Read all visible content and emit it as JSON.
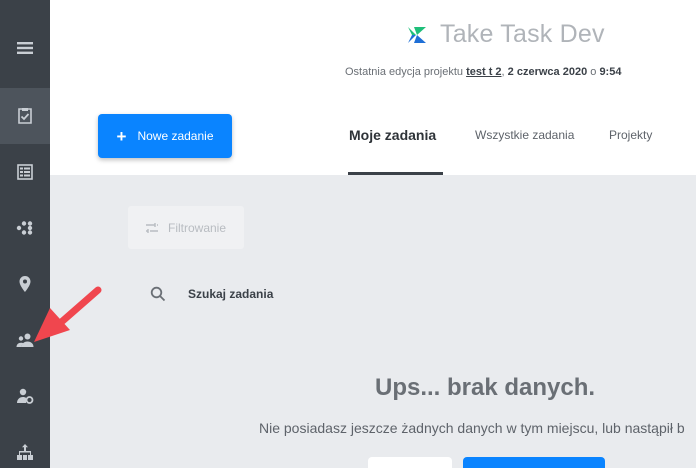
{
  "sidebar": {
    "items": [
      {
        "icon": "menu-icon"
      },
      {
        "icon": "task-check-icon",
        "active": true
      },
      {
        "icon": "checklist-icon"
      },
      {
        "icon": "nodes-icon"
      },
      {
        "icon": "location-pin-icon"
      },
      {
        "icon": "users-icon"
      },
      {
        "icon": "user-settings-icon"
      },
      {
        "icon": "org-chart-icon"
      }
    ]
  },
  "header": {
    "app_name": "Take Task Dev",
    "last_edit_prefix": "Ostatnia edycja projektu",
    "last_edit_project": "test t 2",
    "last_edit_date": "2 czerwca 2020",
    "last_edit_sep": "o",
    "last_edit_time": "9:54",
    "new_task_plus": "+",
    "new_task_label": "Nowe zadanie",
    "tabs": [
      {
        "label": "Moje zadania",
        "active": true
      },
      {
        "label": "Wszystkie zadania"
      },
      {
        "label": "Projekty"
      }
    ]
  },
  "content": {
    "filter_label": "Filtrowanie",
    "search_placeholder": "Szukaj zadania",
    "empty_title": "Ups... brak danych.",
    "empty_desc": "Nie posiadasz jeszcze żadnych danych w tym miejscu, lub nastąpił b"
  },
  "colors": {
    "sidebar": "#3b4148",
    "accent": "#0a84ff",
    "annotation": "#f0464e",
    "logo_green": "#1fbf7a",
    "logo_blue": "#1f6fd6"
  }
}
